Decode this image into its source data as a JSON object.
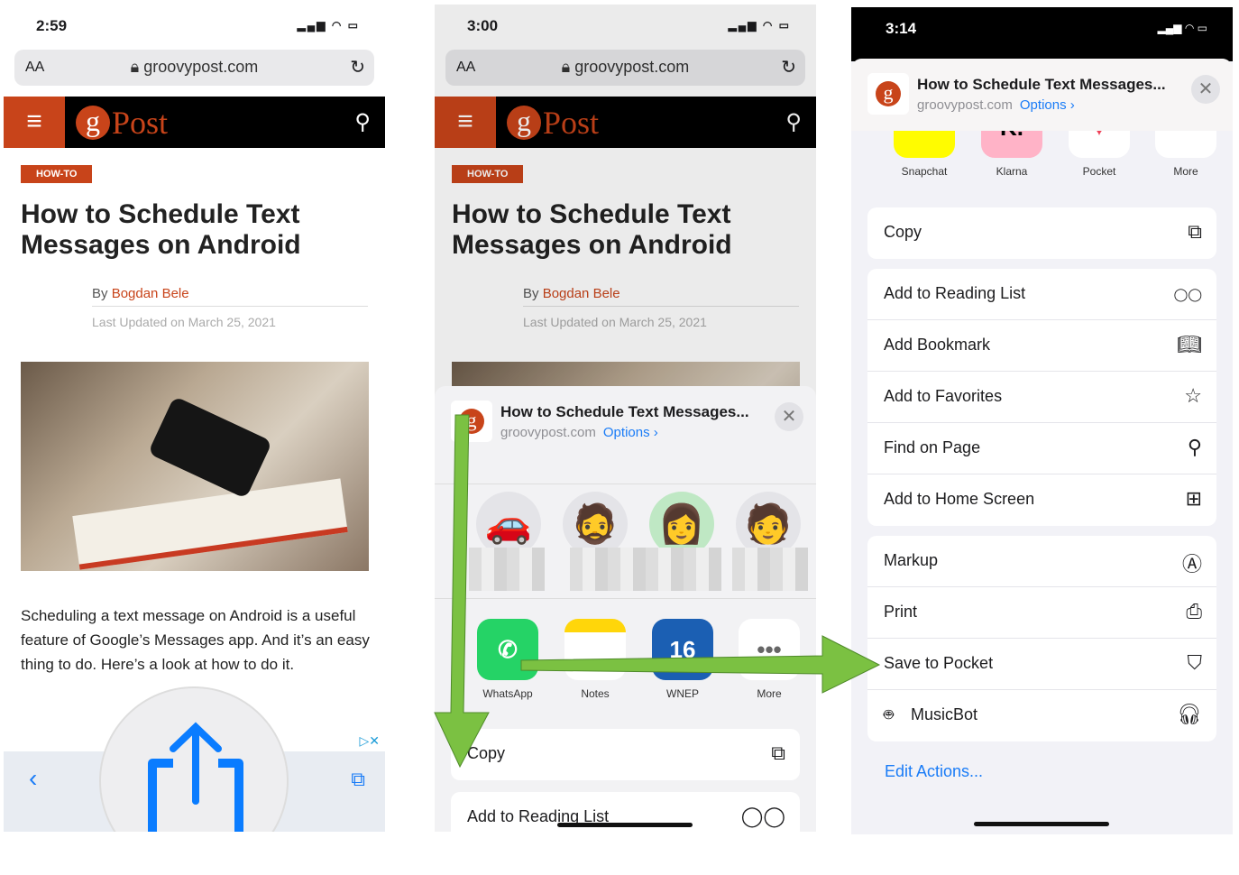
{
  "panel1": {
    "status": {
      "time": "2:59",
      "icons": "signal-icon wifi-icon battery-icon"
    },
    "urlbar": {
      "aa": "AA",
      "url": "groovypost.com"
    },
    "site": {
      "logo_text": "Post",
      "logo_letter": "g"
    },
    "tag": "HOW-TO",
    "title": "How to Schedule Text Messages on Android",
    "byline": {
      "by": "By",
      "author": "Bogdan Bele"
    },
    "updated": "Last Updated on March 25, 2021",
    "paragraph": "Scheduling a text message on Android is a useful feature of Google’s Messages app. And it’s an easy thing to do. Here’s a look at how to do it."
  },
  "panel2": {
    "status": {
      "time": "3:00"
    },
    "urlbar": {
      "aa": "AA",
      "url": "groovypost.com"
    },
    "tag": "HOW-TO",
    "title": "How to Schedule Text Messages on Android",
    "byline": {
      "by": "By",
      "author": "Bogdan Bele"
    },
    "updated": "Last Updated on March 25, 2021",
    "sheet": {
      "title": "How to Schedule Text Messages...",
      "domain": "groovypost.com",
      "options": "Options ›",
      "apps": [
        {
          "label": "WhatsApp",
          "color": "#25d366"
        },
        {
          "label": "Notes",
          "color": "#ffd60a"
        },
        {
          "label": "WNEP",
          "color": "#1b5fb3"
        },
        {
          "label": "More",
          "color": "#ffffff"
        }
      ],
      "actions": [
        {
          "label": "Copy",
          "icon": "copy-icon"
        },
        {
          "label": "Add to Reading List",
          "icon": "glasses-icon"
        }
      ]
    },
    "arrow_color": "#7bc142"
  },
  "panel3": {
    "status": {
      "time": "3:14"
    },
    "sheet": {
      "title": "How to Schedule Text Messages...",
      "domain": "groovypost.com",
      "options": "Options ›",
      "apps": [
        {
          "label": "Snapchat",
          "color": "#fffc00"
        },
        {
          "label": "Klarna",
          "color": "#ffb3c7"
        },
        {
          "label": "Pocket",
          "color": "#ffffff"
        },
        {
          "label": "More",
          "color": "#ffffff"
        }
      ],
      "groups": [
        [
          {
            "label": "Copy",
            "icon": "copy-icon"
          }
        ],
        [
          {
            "label": "Add to Reading List",
            "icon": "glasses-icon"
          },
          {
            "label": "Add Bookmark",
            "icon": "book-icon"
          },
          {
            "label": "Add to Favorites",
            "icon": "star-icon"
          },
          {
            "label": "Find on Page",
            "icon": "search-icon"
          },
          {
            "label": "Add to Home Screen",
            "icon": "plus-square-icon"
          }
        ],
        [
          {
            "label": "Markup",
            "icon": "markup-icon"
          },
          {
            "label": "Print",
            "icon": "printer-icon"
          },
          {
            "label": "Save to Pocket",
            "icon": "pocket-icon"
          },
          {
            "label": "MusicBot",
            "icon": "headphones-icon"
          }
        ]
      ],
      "edit_actions": "Edit Actions..."
    }
  }
}
